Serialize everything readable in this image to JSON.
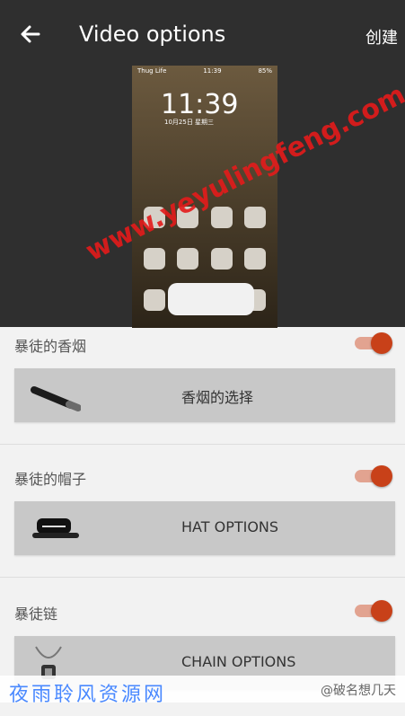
{
  "header": {
    "title": "Video options",
    "action": "创建"
  },
  "preview": {
    "status_left": "Thug Life",
    "status_time": "11:39",
    "status_right": "85%",
    "clock": "11:39",
    "date": "10月25日 星期三",
    "watermark": "www.yeyulingfeng.com"
  },
  "sections": {
    "cigarette": {
      "label": "暴徒的香烟",
      "enabled": true,
      "option": "香烟的选择"
    },
    "hat": {
      "label": "暴徒的帽子",
      "enabled": true,
      "option": "HAT OPTIONS"
    },
    "chain": {
      "label": "暴徒链",
      "enabled": true,
      "option": "CHAIN OPTIONS"
    }
  },
  "footer": {
    "left": "夜雨聆风资源网",
    "right": "@破名想几天"
  },
  "colors": {
    "header_bg": "#2f2f2f",
    "toggle_on": "#c84119",
    "toggle_track": "#e2a390",
    "option_box": "#c8c8c8"
  }
}
